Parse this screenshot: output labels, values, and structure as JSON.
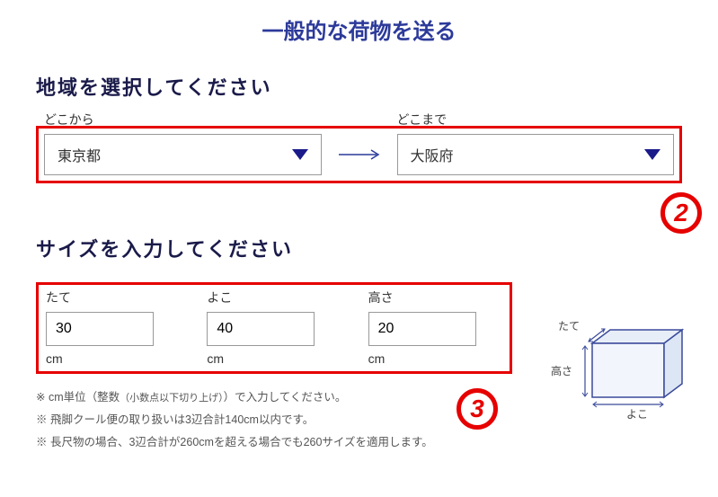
{
  "title": "一般的な荷物を送る",
  "region": {
    "heading": "地域を選択してください",
    "from_label": "どこから",
    "to_label": "どこまで",
    "from_value": "東京都",
    "to_value": "大阪府"
  },
  "size": {
    "heading": "サイズを入力してください",
    "height_label": "たて",
    "width_label": "よこ",
    "depth_label": "高さ",
    "height_value": "30",
    "width_value": "40",
    "depth_value": "20",
    "unit": "cm"
  },
  "notes": {
    "line1_pre": "※ cm単位（整数",
    "line1_small": "（小数点以下切り上げ）",
    "line1_post": "）で入力してください。",
    "line2": "※ 飛脚クール便の取り扱いは3辺合計140cm以内です。",
    "line3": "※ 長尺物の場合、3辺合計が260cmを超える場合でも260サイズを適用します。"
  },
  "diagram": {
    "tate": "たて",
    "yoko": "よこ",
    "takasa": "高さ"
  },
  "markers": {
    "m2": "2",
    "m3": "3"
  }
}
